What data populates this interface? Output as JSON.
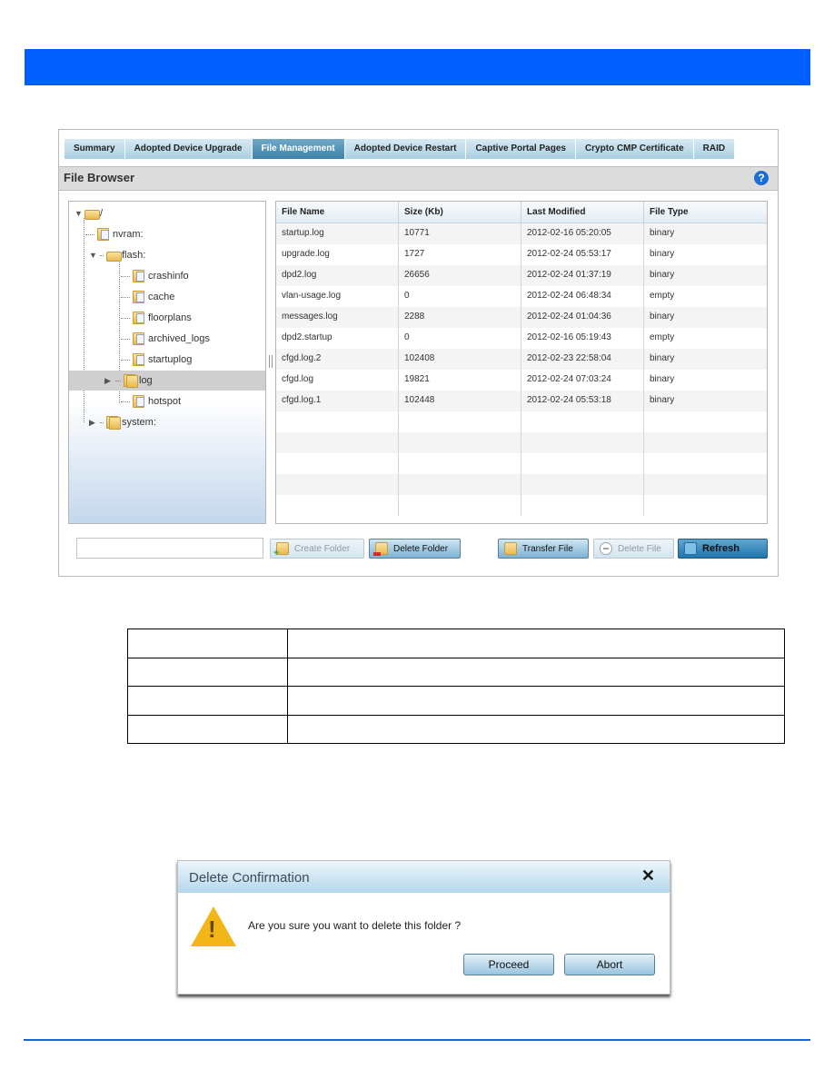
{
  "colors": {
    "header_bar": "#005ffe",
    "footer_line": "#1a62d6",
    "tab_active": "#3e82a8",
    "tab_inactive": "#a9cfe2",
    "help_icon": "#1b6ed6",
    "warning": "#f2b619"
  },
  "tabs": [
    {
      "label": "Summary",
      "active": false
    },
    {
      "label": "Adopted Device Upgrade",
      "active": false
    },
    {
      "label": "File Management",
      "active": true
    },
    {
      "label": "Adopted Device Restart",
      "active": false
    },
    {
      "label": "Captive Portal Pages",
      "active": false
    },
    {
      "label": "Crypto CMP Certificate",
      "active": false
    },
    {
      "label": "RAID",
      "active": false
    }
  ],
  "section": {
    "title": "File Browser",
    "help_icon": "?"
  },
  "tree": [
    {
      "label": "/",
      "icon": "folder-open-icon",
      "expanded": true
    },
    {
      "label": "nvram:",
      "icon": "folder-doc-icon"
    },
    {
      "label": "flash:",
      "icon": "folder-open-icon",
      "expanded": true
    },
    {
      "label": "crashinfo",
      "icon": "folder-doc-icon"
    },
    {
      "label": "cache",
      "icon": "folder-doc-icon"
    },
    {
      "label": "floorplans",
      "icon": "folder-doc-icon"
    },
    {
      "label": "archived_logs",
      "icon": "folder-doc-icon"
    },
    {
      "label": "startuplog",
      "icon": "folder-doc-icon"
    },
    {
      "label": "log",
      "icon": "folder-stack-icon",
      "selected": true,
      "collapsed": true
    },
    {
      "label": "hotspot",
      "icon": "folder-doc-icon"
    },
    {
      "label": "system:",
      "icon": "folder-stack-icon",
      "collapsed": true
    }
  ],
  "grid": {
    "columns": [
      "File Name",
      "Size (Kb)",
      "Last Modified",
      "File Type"
    ],
    "rows": [
      [
        "startup.log",
        "10771",
        "2012-02-16 05:20:05",
        "binary"
      ],
      [
        "upgrade.log",
        "1727",
        "2012-02-24 05:53:17",
        "binary"
      ],
      [
        "dpd2.log",
        "26656",
        "2012-02-24 01:37:19",
        "binary"
      ],
      [
        "vlan-usage.log",
        "0",
        "2012-02-24 06:48:34",
        "empty"
      ],
      [
        "messages.log",
        "2288",
        "2012-02-24 01:04:36",
        "binary"
      ],
      [
        "dpd2.startup",
        "0",
        "2012-02-16 05:19:43",
        "empty"
      ],
      [
        "cfgd.log.2",
        "102408",
        "2012-02-23 22:58:04",
        "binary"
      ],
      [
        "cfgd.log",
        "19821",
        "2012-02-24 07:03:24",
        "binary"
      ],
      [
        "cfgd.log.1",
        "102448",
        "2012-02-24 05:53:18",
        "binary"
      ]
    ]
  },
  "folder_name_input": {
    "value": "",
    "placeholder": ""
  },
  "buttons": {
    "create_folder": "Create Folder",
    "delete_folder": "Delete Folder",
    "transfer_file": "Transfer File",
    "delete_file": "Delete File",
    "refresh": "Refresh"
  },
  "dialog": {
    "title": "Delete Confirmation",
    "close": "✕",
    "message": "Are you sure you want to delete this folder ?",
    "warning_mark": "!",
    "proceed": "Proceed",
    "abort": "Abort"
  }
}
